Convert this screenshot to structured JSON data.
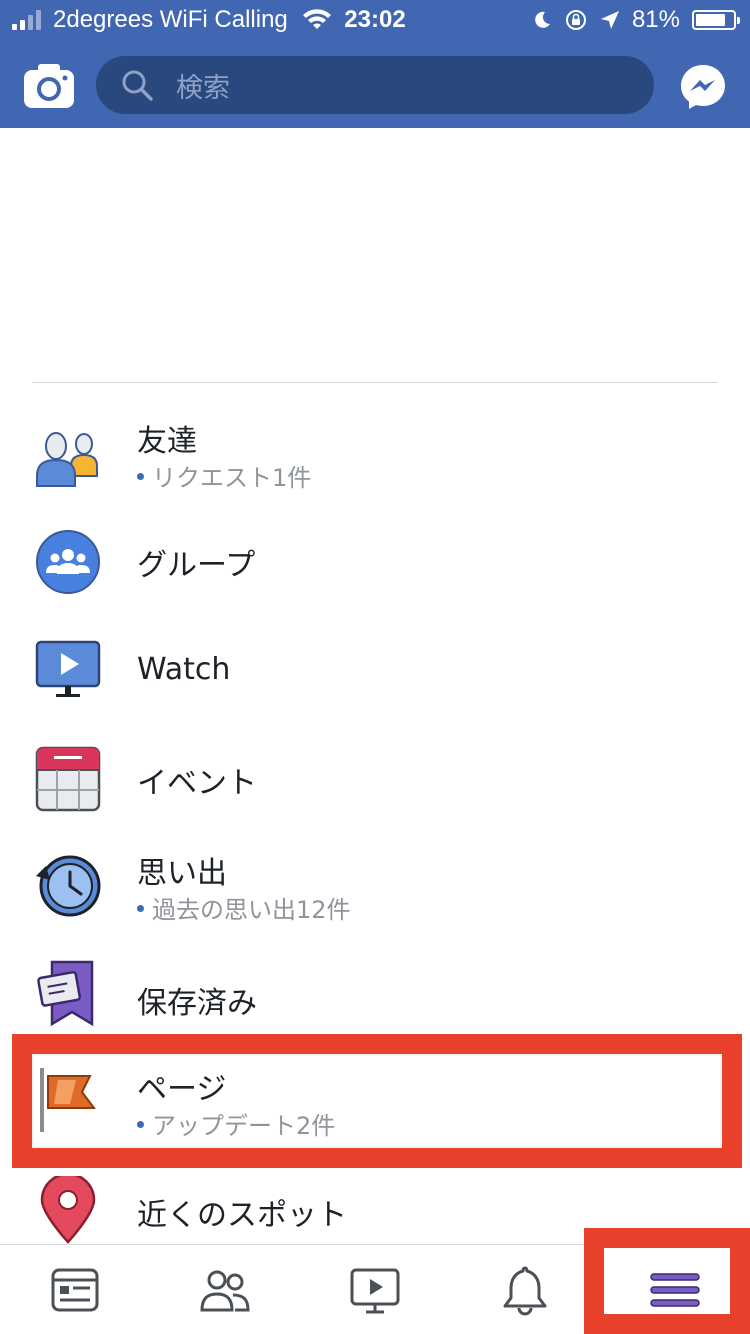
{
  "status_bar": {
    "carrier": "2degrees WiFi Calling",
    "time": "23:02",
    "battery": "81%",
    "battery_level": 0.81
  },
  "header": {
    "search_placeholder": "検索",
    "brand_color": "#4267b2",
    "search_bg_color": "#29487d"
  },
  "menu": {
    "items": [
      {
        "label": "友達",
        "sub": "リクエスト1件",
        "icon": "friends-icon"
      },
      {
        "label": "グループ",
        "icon": "groups-icon"
      },
      {
        "label": "Watch",
        "icon": "watch-icon"
      },
      {
        "label": "イベント",
        "icon": "events-calendar-icon"
      },
      {
        "label": "思い出",
        "sub": "過去の思い出12件",
        "icon": "memories-clock-icon"
      },
      {
        "label": "保存済み",
        "icon": "saved-bookmark-icon"
      },
      {
        "label": "ページ",
        "sub": "アップデート2件",
        "icon": "pages-flag-icon"
      },
      {
        "label": "近くのスポット",
        "icon": "nearby-pin-icon"
      }
    ],
    "highlight_color": "#e8402a"
  },
  "tab_bar": {
    "tabs": [
      {
        "icon": "news-feed-icon"
      },
      {
        "icon": "friends-tab-icon"
      },
      {
        "icon": "watch-tab-icon"
      },
      {
        "icon": "notifications-bell-icon"
      },
      {
        "icon": "menu-hamburger-icon",
        "active": true
      }
    ],
    "active_color": "#7b5cc4"
  }
}
